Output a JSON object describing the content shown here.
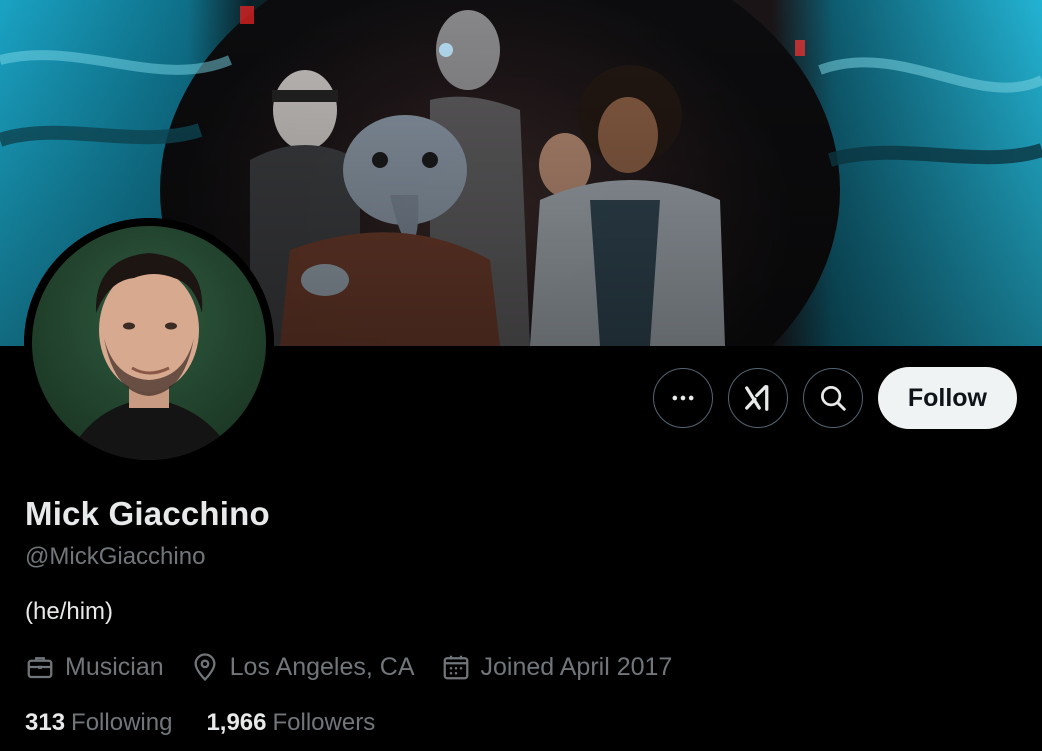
{
  "profile": {
    "display_name": "Mick Giacchino",
    "handle": "@MickGiacchino",
    "bio": "(he/him)",
    "profession": "Musician",
    "location": "Los Angeles, CA",
    "joined": "Joined April 2017"
  },
  "stats": {
    "following_count": "313",
    "following_label": "Following",
    "followers_count": "1,966",
    "followers_label": "Followers"
  },
  "actions": {
    "more_icon": "more-dots-icon",
    "grok_icon": "grok-icon",
    "search_icon": "search-icon",
    "follow_label": "Follow"
  },
  "colors": {
    "background": "#000000",
    "primary_text": "#e7e9ea",
    "secondary_text": "#71767b",
    "button_border": "#536471",
    "follow_bg": "#eff3f4",
    "follow_text": "#0f1419"
  }
}
